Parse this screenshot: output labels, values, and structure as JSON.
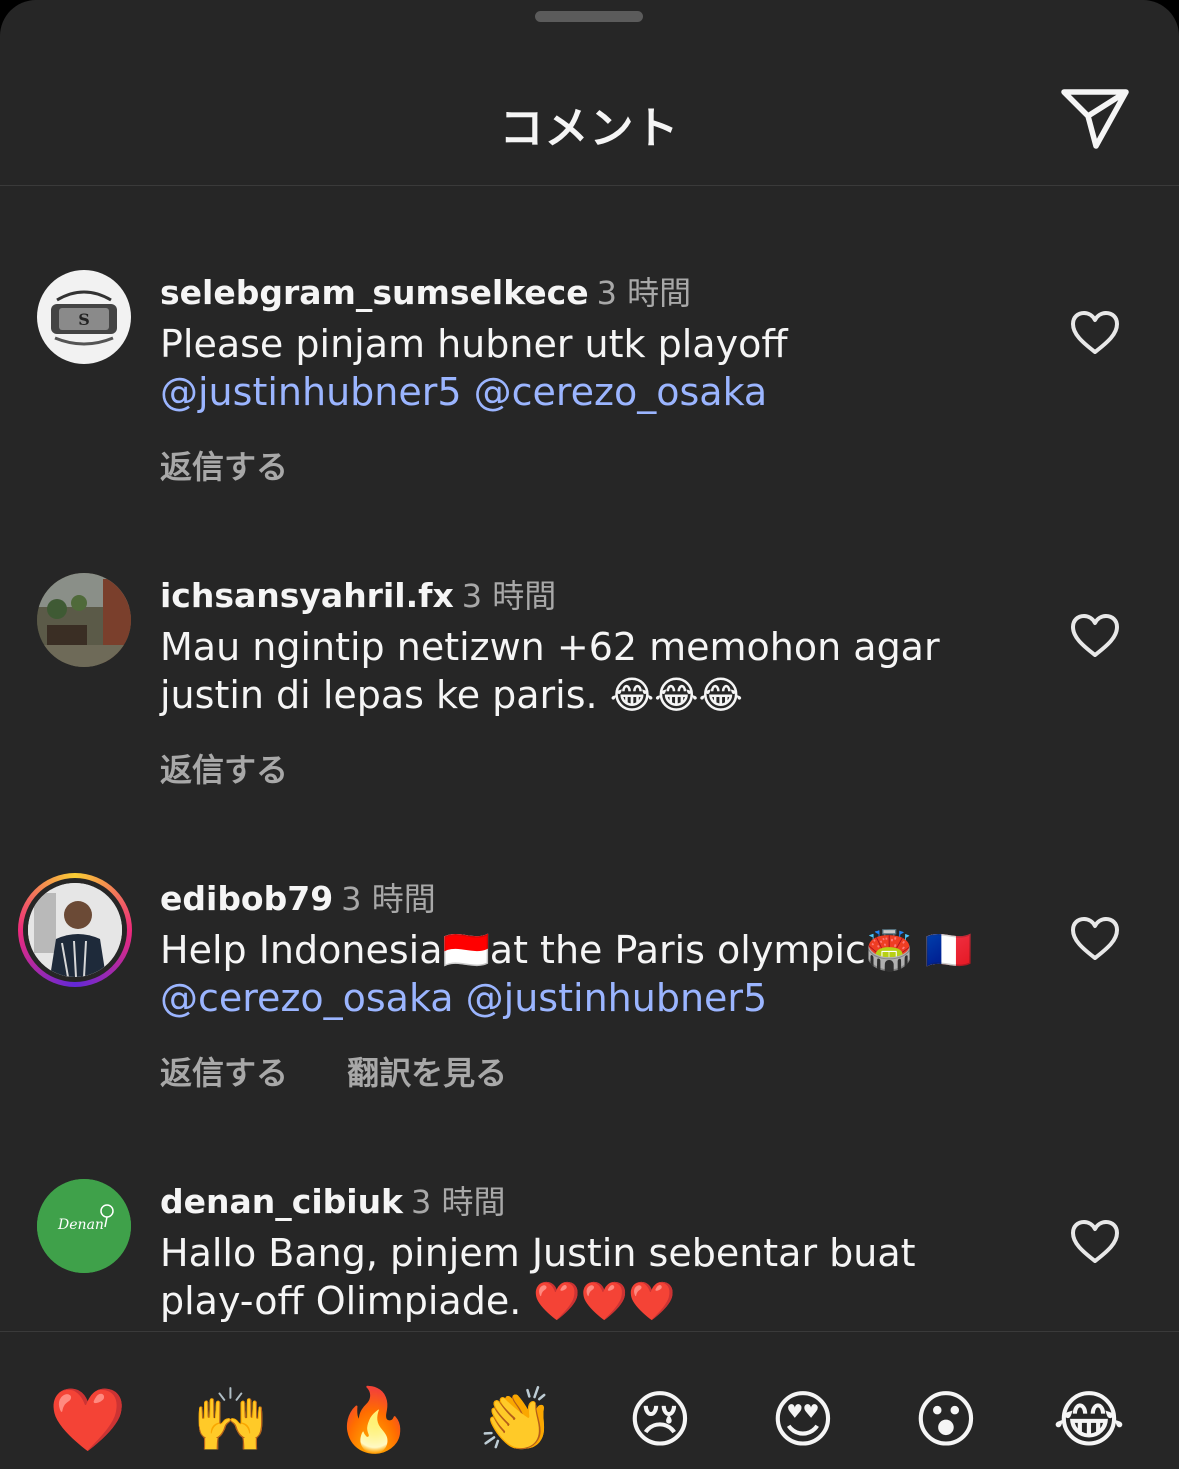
{
  "header": {
    "title": "コメント"
  },
  "comments": [
    {
      "username": "selebgram_sumselkece",
      "time": "3 時間",
      "text_plain": "Please pinjam hubner utk playoff",
      "mentions": "@justinhubner5 @cerezo_osaka",
      "reply": "返信する"
    },
    {
      "username": "ichsansyahril.fx",
      "time": "3 時間",
      "line1": "Mau ngintip netizwn +62 memohon agar",
      "line2": "justin di lepas ke paris. 😂😂😂",
      "reply": "返信する"
    },
    {
      "username": "edibob79",
      "time": "3 時間",
      "line1": "Help Indonesia🇮🇩at the Paris olympic🏟️ 🇫🇷",
      "mentions": "@cerezo_osaka @justinhubner5",
      "reply": "返信する",
      "translate": "翻訳を見る"
    },
    {
      "username": "denan_cibiuk",
      "time": "3 時間",
      "line1": "Hallo Bang, pinjem Justin sebentar buat",
      "line2": "play-off Olimpiade. ❤️❤️❤️",
      "avatar_text": "Denan"
    }
  ],
  "emoji_bar": [
    "❤️",
    "🙌",
    "🔥",
    "👏",
    "😢",
    "😍",
    "😮",
    "😂"
  ]
}
